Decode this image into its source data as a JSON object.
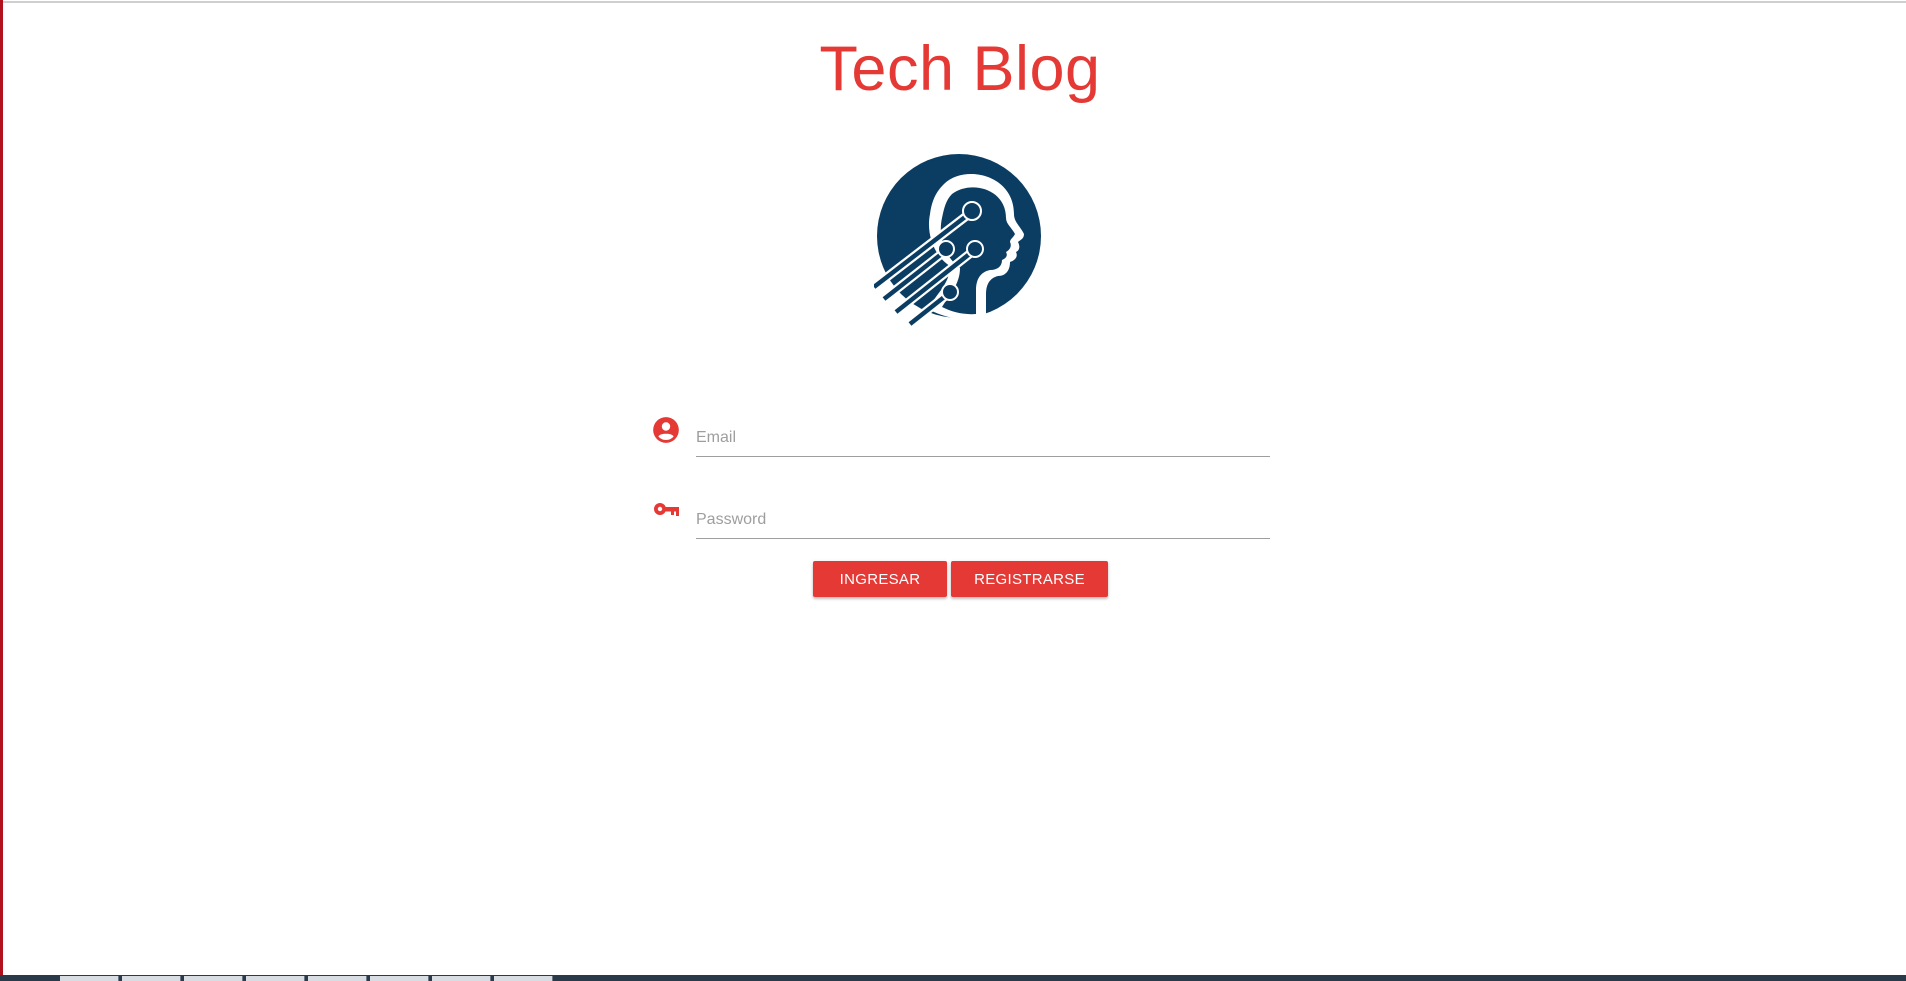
{
  "header": {
    "title": "Tech Blog"
  },
  "form": {
    "email_placeholder": "Email",
    "password_placeholder": "Password",
    "login_label": "INGRESAR",
    "register_label": "REGISTRARSE"
  },
  "icons": {
    "logo": "tech-head-logo",
    "email": "account-circle-icon",
    "password": "key-icon"
  },
  "colors": {
    "accent": "#e53935",
    "logo": "#0b3d63",
    "left_border": "#b3101d"
  }
}
